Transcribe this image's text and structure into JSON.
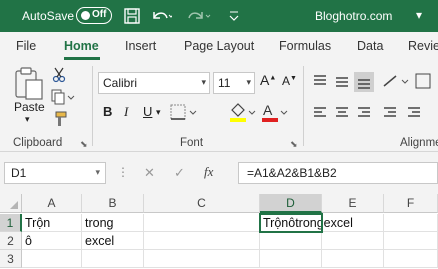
{
  "titlebar": {
    "autosave_label": "AutoSave",
    "autosave_state": "Off",
    "title": "Bloghotro.com",
    "title_chevron": "▾",
    "icons": [
      "save-icon",
      "undo-icon",
      "redo-icon",
      "customize-qat-icon"
    ]
  },
  "tabs": [
    {
      "label": "File"
    },
    {
      "label": "Home",
      "active": true
    },
    {
      "label": "Insert"
    },
    {
      "label": "Page Layout"
    },
    {
      "label": "Formulas"
    },
    {
      "label": "Data"
    },
    {
      "label": "Revie"
    }
  ],
  "ribbon": {
    "clipboard_label": "Clipboard",
    "paste_label": "Paste",
    "font_label": "Font",
    "alignment_label": "Alignme",
    "font_name": "Calibri",
    "font_size": "11",
    "bold": "B",
    "italic": "I",
    "underline": "U"
  },
  "formula_bar": {
    "name_box": "D1",
    "dots": "⋮",
    "cancel": "✕",
    "enter": "✓",
    "fx": "fx",
    "formula": "=A1&A2&B1&B2"
  },
  "grid": {
    "columns": [
      "A",
      "B",
      "C",
      "D",
      "E",
      "F"
    ],
    "rows": [
      "1",
      "2",
      "3"
    ],
    "cells": {
      "A1": "Trộn",
      "B1": "trong",
      "D1": "Trộnôtrongexcel",
      "A2": "ô",
      "B2": "excel"
    },
    "selected": "D1"
  },
  "colors": {
    "accent": "#217346",
    "font_color_bar": "#e02020",
    "highlight_bar": "#ffff00"
  }
}
